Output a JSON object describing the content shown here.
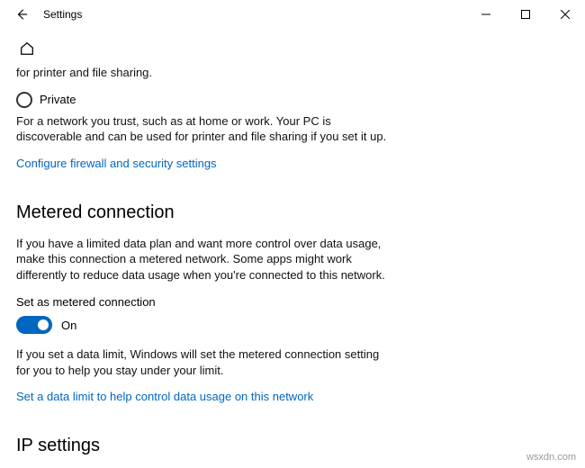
{
  "window": {
    "title": "Settings"
  },
  "content": {
    "top_fragment": "for printer and file sharing.",
    "private": {
      "label": "Private",
      "description": "For a network you trust, such as at home or work. Your PC is discoverable and can be used for printer and file sharing if you set it up."
    },
    "firewall_link": "Configure firewall and security settings",
    "metered": {
      "heading": "Metered connection",
      "description": "If you have a limited data plan and want more control over data usage, make this connection a metered network. Some apps might work differently to reduce data usage when you're connected to this network.",
      "toggle_label": "Set as metered connection",
      "toggle_state": "On",
      "note": "If you set a data limit, Windows will set the metered connection setting for you to help you stay under your limit.",
      "link": "Set a data limit to help control data usage on this network"
    },
    "ip": {
      "heading": "IP settings"
    }
  },
  "watermark": "wsxdn.com"
}
